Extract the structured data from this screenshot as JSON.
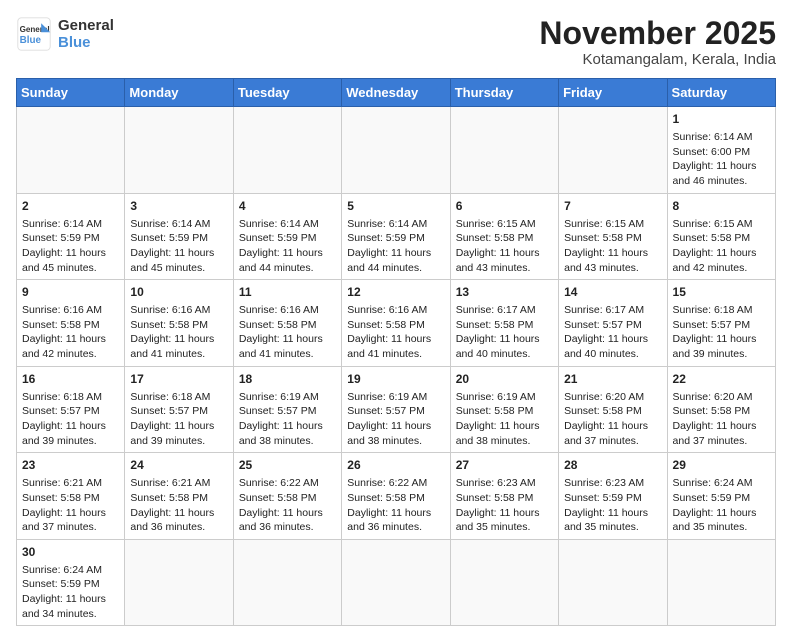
{
  "header": {
    "logo_general": "General",
    "logo_blue": "Blue",
    "month_year": "November 2025",
    "location": "Kotamangalam, Kerala, India"
  },
  "days_of_week": [
    "Sunday",
    "Monday",
    "Tuesday",
    "Wednesday",
    "Thursday",
    "Friday",
    "Saturday"
  ],
  "weeks": [
    [
      {
        "day": "",
        "info": ""
      },
      {
        "day": "",
        "info": ""
      },
      {
        "day": "",
        "info": ""
      },
      {
        "day": "",
        "info": ""
      },
      {
        "day": "",
        "info": ""
      },
      {
        "day": "",
        "info": ""
      },
      {
        "day": "1",
        "info": "Sunrise: 6:14 AM\nSunset: 6:00 PM\nDaylight: 11 hours and 46 minutes."
      }
    ],
    [
      {
        "day": "2",
        "info": "Sunrise: 6:14 AM\nSunset: 5:59 PM\nDaylight: 11 hours and 45 minutes."
      },
      {
        "day": "3",
        "info": "Sunrise: 6:14 AM\nSunset: 5:59 PM\nDaylight: 11 hours and 45 minutes."
      },
      {
        "day": "4",
        "info": "Sunrise: 6:14 AM\nSunset: 5:59 PM\nDaylight: 11 hours and 44 minutes."
      },
      {
        "day": "5",
        "info": "Sunrise: 6:14 AM\nSunset: 5:59 PM\nDaylight: 11 hours and 44 minutes."
      },
      {
        "day": "6",
        "info": "Sunrise: 6:15 AM\nSunset: 5:58 PM\nDaylight: 11 hours and 43 minutes."
      },
      {
        "day": "7",
        "info": "Sunrise: 6:15 AM\nSunset: 5:58 PM\nDaylight: 11 hours and 43 minutes."
      },
      {
        "day": "8",
        "info": "Sunrise: 6:15 AM\nSunset: 5:58 PM\nDaylight: 11 hours and 42 minutes."
      }
    ],
    [
      {
        "day": "9",
        "info": "Sunrise: 6:16 AM\nSunset: 5:58 PM\nDaylight: 11 hours and 42 minutes."
      },
      {
        "day": "10",
        "info": "Sunrise: 6:16 AM\nSunset: 5:58 PM\nDaylight: 11 hours and 41 minutes."
      },
      {
        "day": "11",
        "info": "Sunrise: 6:16 AM\nSunset: 5:58 PM\nDaylight: 11 hours and 41 minutes."
      },
      {
        "day": "12",
        "info": "Sunrise: 6:16 AM\nSunset: 5:58 PM\nDaylight: 11 hours and 41 minutes."
      },
      {
        "day": "13",
        "info": "Sunrise: 6:17 AM\nSunset: 5:58 PM\nDaylight: 11 hours and 40 minutes."
      },
      {
        "day": "14",
        "info": "Sunrise: 6:17 AM\nSunset: 5:57 PM\nDaylight: 11 hours and 40 minutes."
      },
      {
        "day": "15",
        "info": "Sunrise: 6:18 AM\nSunset: 5:57 PM\nDaylight: 11 hours and 39 minutes."
      }
    ],
    [
      {
        "day": "16",
        "info": "Sunrise: 6:18 AM\nSunset: 5:57 PM\nDaylight: 11 hours and 39 minutes."
      },
      {
        "day": "17",
        "info": "Sunrise: 6:18 AM\nSunset: 5:57 PM\nDaylight: 11 hours and 39 minutes."
      },
      {
        "day": "18",
        "info": "Sunrise: 6:19 AM\nSunset: 5:57 PM\nDaylight: 11 hours and 38 minutes."
      },
      {
        "day": "19",
        "info": "Sunrise: 6:19 AM\nSunset: 5:57 PM\nDaylight: 11 hours and 38 minutes."
      },
      {
        "day": "20",
        "info": "Sunrise: 6:19 AM\nSunset: 5:58 PM\nDaylight: 11 hours and 38 minutes."
      },
      {
        "day": "21",
        "info": "Sunrise: 6:20 AM\nSunset: 5:58 PM\nDaylight: 11 hours and 37 minutes."
      },
      {
        "day": "22",
        "info": "Sunrise: 6:20 AM\nSunset: 5:58 PM\nDaylight: 11 hours and 37 minutes."
      }
    ],
    [
      {
        "day": "23",
        "info": "Sunrise: 6:21 AM\nSunset: 5:58 PM\nDaylight: 11 hours and 37 minutes."
      },
      {
        "day": "24",
        "info": "Sunrise: 6:21 AM\nSunset: 5:58 PM\nDaylight: 11 hours and 36 minutes."
      },
      {
        "day": "25",
        "info": "Sunrise: 6:22 AM\nSunset: 5:58 PM\nDaylight: 11 hours and 36 minutes."
      },
      {
        "day": "26",
        "info": "Sunrise: 6:22 AM\nSunset: 5:58 PM\nDaylight: 11 hours and 36 minutes."
      },
      {
        "day": "27",
        "info": "Sunrise: 6:23 AM\nSunset: 5:58 PM\nDaylight: 11 hours and 35 minutes."
      },
      {
        "day": "28",
        "info": "Sunrise: 6:23 AM\nSunset: 5:59 PM\nDaylight: 11 hours and 35 minutes."
      },
      {
        "day": "29",
        "info": "Sunrise: 6:24 AM\nSunset: 5:59 PM\nDaylight: 11 hours and 35 minutes."
      }
    ],
    [
      {
        "day": "30",
        "info": "Sunrise: 6:24 AM\nSunset: 5:59 PM\nDaylight: 11 hours and 34 minutes."
      },
      {
        "day": "",
        "info": ""
      },
      {
        "day": "",
        "info": ""
      },
      {
        "day": "",
        "info": ""
      },
      {
        "day": "",
        "info": ""
      },
      {
        "day": "",
        "info": ""
      },
      {
        "day": "",
        "info": ""
      }
    ]
  ]
}
